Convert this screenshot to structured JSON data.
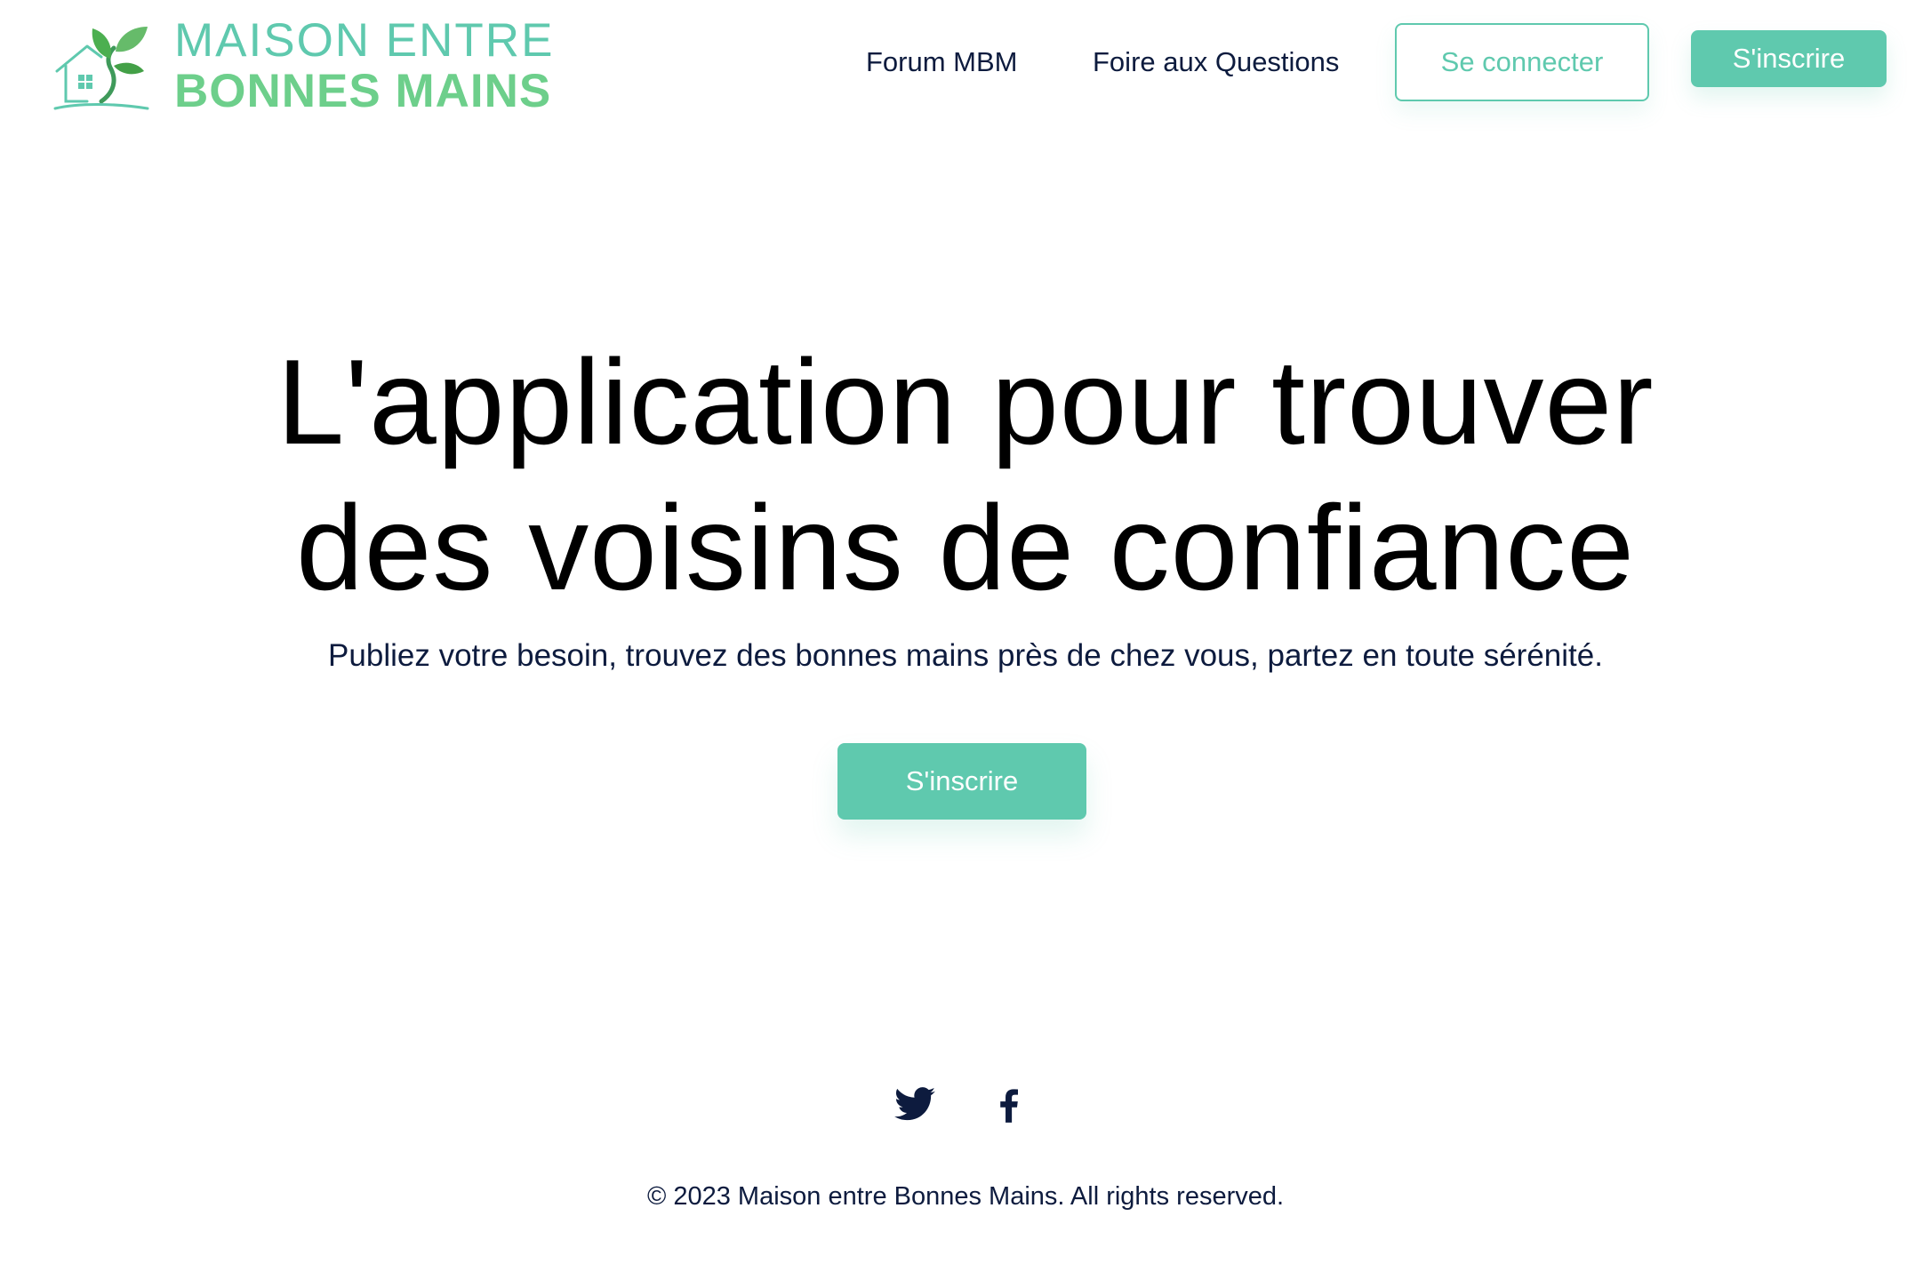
{
  "header": {
    "logo": {
      "line1": "MAISON ENTRE",
      "line2": "BONNES MAINS",
      "icon": "house-leaves-logo"
    },
    "nav": {
      "forum_label": "Forum MBM",
      "faq_label": "Foire aux Questions"
    },
    "login_label": "Se connecter",
    "signup_label": "S'inscrire"
  },
  "hero": {
    "title_line1": "L'application pour trouver",
    "title_line2": "des voisins de confiance",
    "subtitle": "Publiez votre besoin, trouvez des bonnes mains près de chez vous, partez en toute sérénité.",
    "cta_label": "S'inscrire"
  },
  "footer": {
    "social": [
      "twitter-icon",
      "facebook-icon"
    ],
    "copyright": "© 2023 Maison entre Bonnes Mains. All rights reserved."
  },
  "colors": {
    "accent": "#5fc9ae",
    "logo_green": "#6dcf8b",
    "text_dark": "#0d1b3e",
    "background": "#ffffff"
  }
}
